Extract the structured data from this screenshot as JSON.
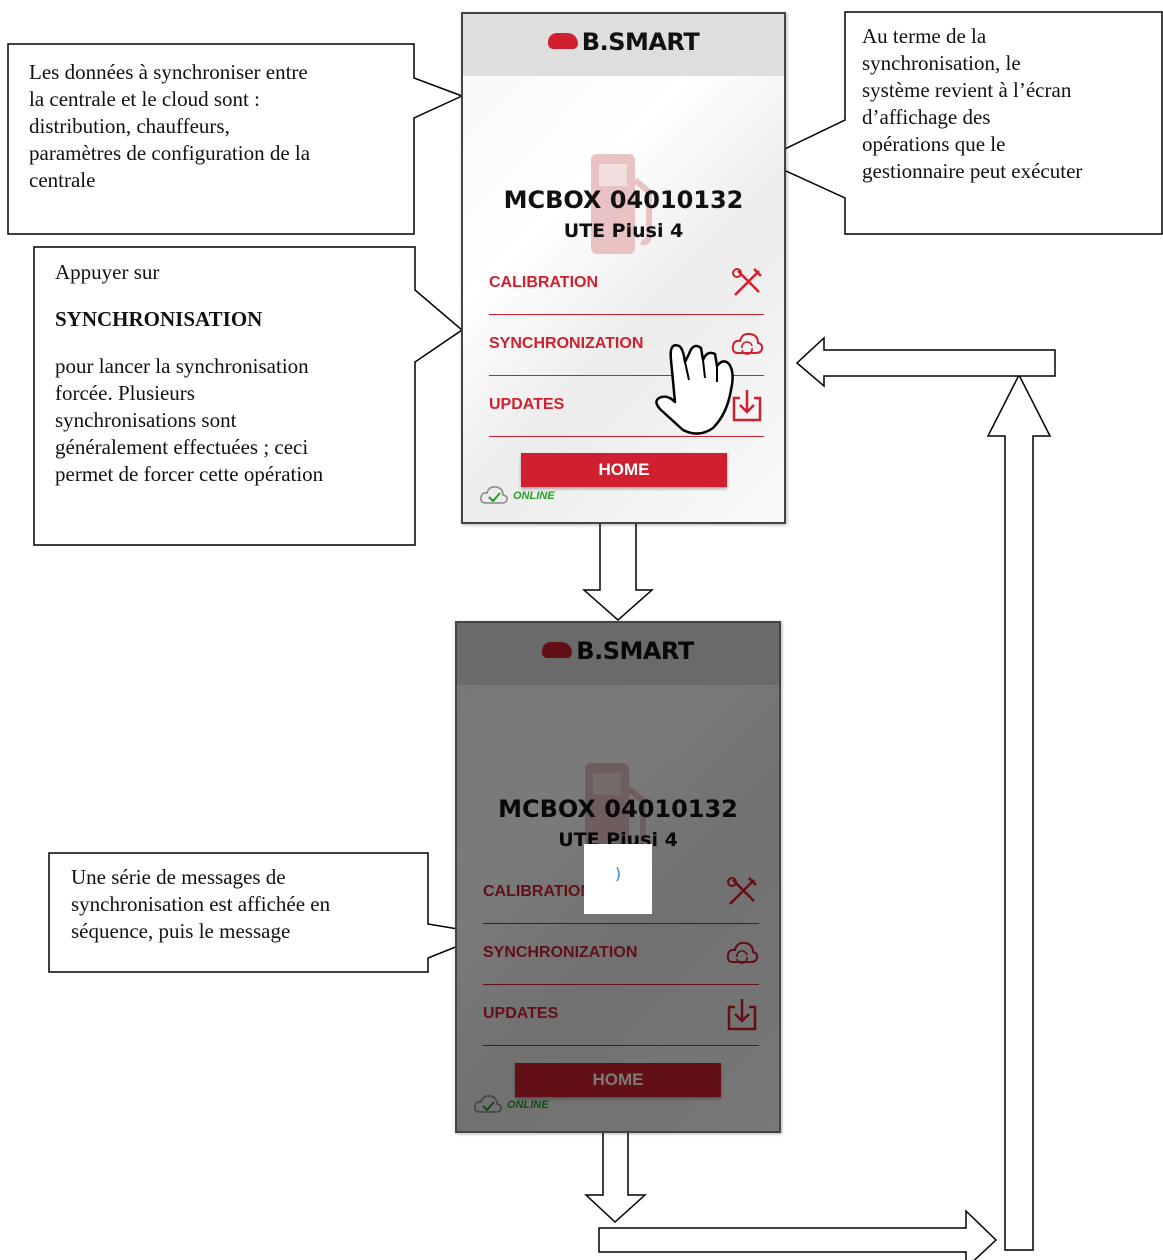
{
  "callouts": {
    "sync_data": [
      "Les données à synchroniser entre",
      "la centrale et le cloud sont :",
      "distribution, chauffeurs,",
      "paramètres de configuration de la",
      "centrale"
    ],
    "end_sync": [
      "Au terme de la",
      "synchronisation, le",
      "système revient à l’écran",
      "d’affichage des",
      "opérations que le",
      "gestionnaire peut exécuter"
    ],
    "press_intro": "Appuyer sur",
    "press_bold": "SYNCHRONISATION",
    "press_rest": [
      "pour lancer la synchronisation",
      "forcée. Plusieurs",
      "synchronisations sont",
      "généralement effectuées ; ceci",
      "permet de forcer cette opération"
    ],
    "messages": [
      "Une série de messages de",
      "synchronisation est affichée en",
      "séquence, puis le message"
    ]
  },
  "app": {
    "brand": "B.SMART",
    "device_id": "MCBOX 04010132",
    "device_name": "UTE Piusi 4",
    "menu": {
      "calibration": "CALIBRATION",
      "synchronization": "SYNCHRONIZATION",
      "updates": "UPDATES"
    },
    "home": "HOME",
    "status": "ONLINE"
  },
  "dialog_text": ")",
  "colors": {
    "brand_red": "#d0202f",
    "status_green": "#2a9d2a"
  }
}
